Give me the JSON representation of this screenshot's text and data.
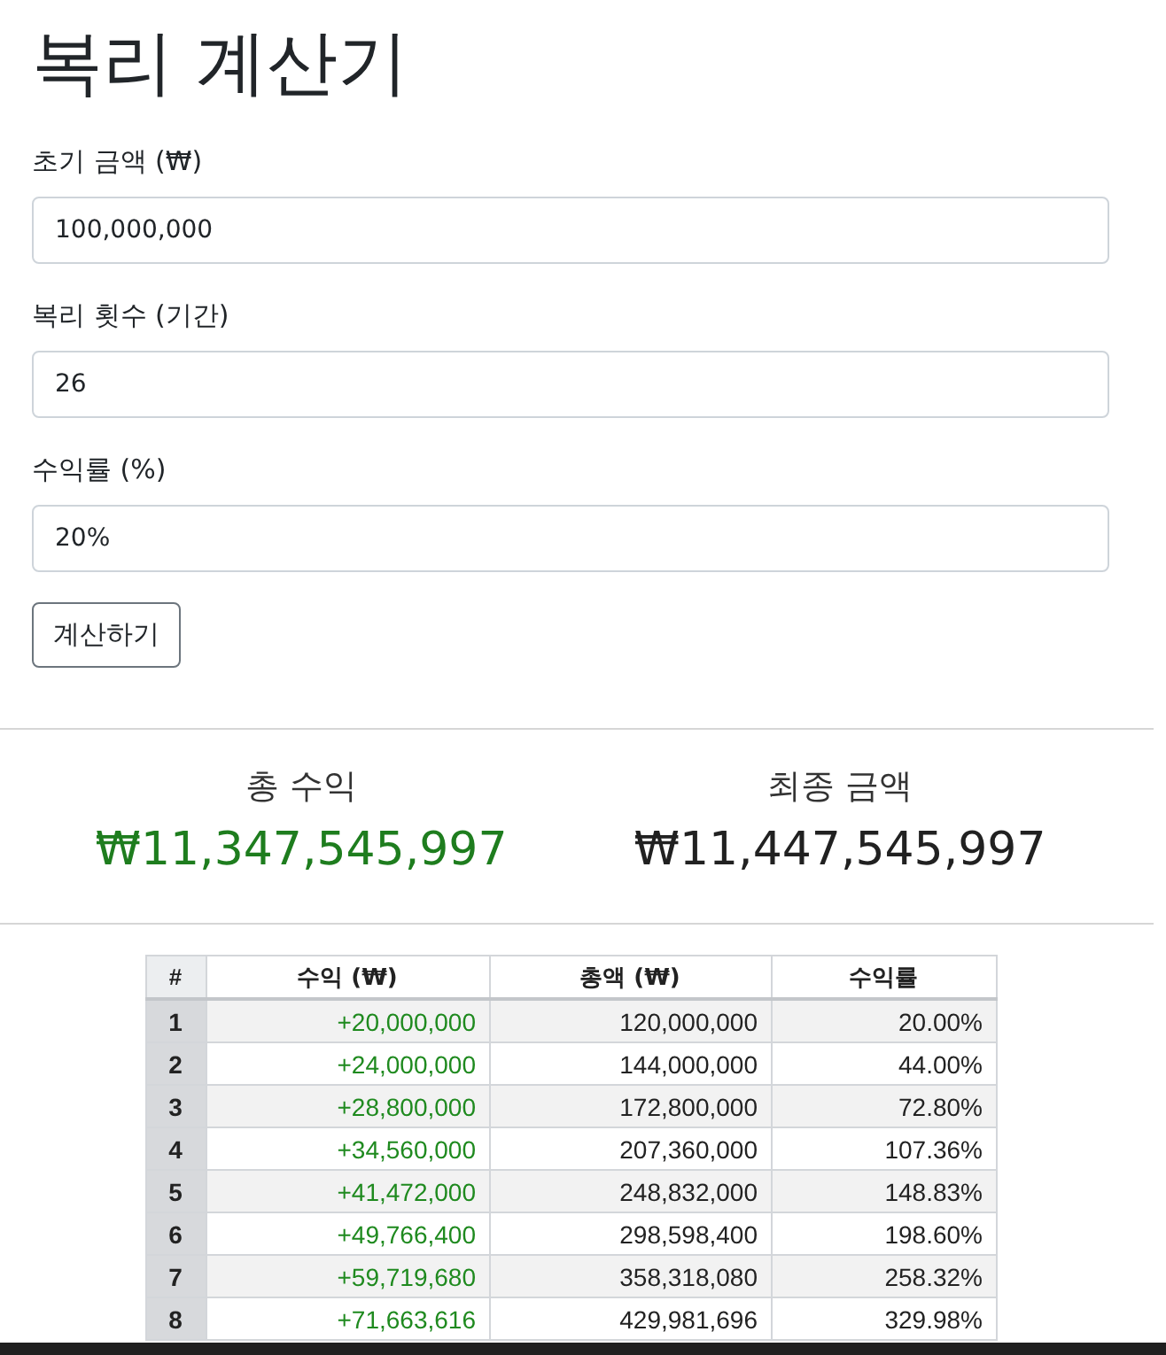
{
  "title": "복리 계산기",
  "form": {
    "fields": [
      {
        "label": "초기 금액 (₩)",
        "value": "100,000,000"
      },
      {
        "label": "복리 횟수 (기간)",
        "value": "26"
      },
      {
        "label": "수익률 (%)",
        "value": "20%"
      }
    ],
    "submit_button": "계산하기"
  },
  "summary": [
    {
      "kind": "profit",
      "label": "총 수익",
      "value": "₩11,347,545,997"
    },
    {
      "kind": "total",
      "label": "최종 금액",
      "value": "₩11,447,545,997"
    }
  ],
  "table": {
    "columns": [
      "#",
      "수익 (₩)",
      "총액 (₩)",
      "수익률"
    ],
    "rows": [
      {
        "index": "1",
        "profit": "+20,000,000",
        "total": "120,000,000",
        "rate": "20.00%"
      },
      {
        "index": "2",
        "profit": "+24,000,000",
        "total": "144,000,000",
        "rate": "44.00%"
      },
      {
        "index": "3",
        "profit": "+28,800,000",
        "total": "172,800,000",
        "rate": "72.80%"
      },
      {
        "index": "4",
        "profit": "+34,560,000",
        "total": "207,360,000",
        "rate": "107.36%"
      },
      {
        "index": "5",
        "profit": "+41,472,000",
        "total": "248,832,000",
        "rate": "148.83%"
      },
      {
        "index": "6",
        "profit": "+49,766,400",
        "total": "298,598,400",
        "rate": "198.60%"
      },
      {
        "index": "7",
        "profit": "+59,719,680",
        "total": "358,318,080",
        "rate": "258.32%"
      },
      {
        "index": "8",
        "profit": "+71,663,616",
        "total": "429,981,696",
        "rate": "329.98%"
      }
    ]
  }
}
